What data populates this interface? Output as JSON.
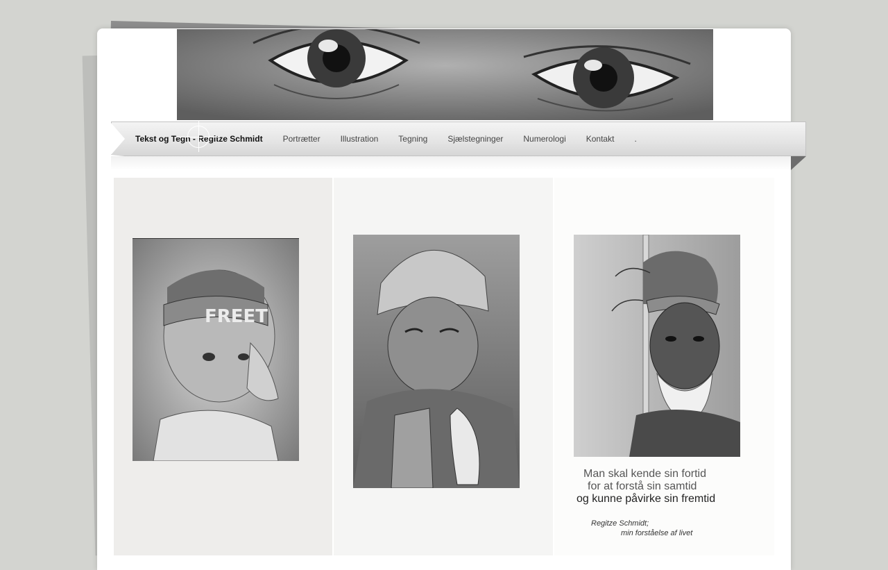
{
  "banner": {
    "image": "eyes-drawing-banner"
  },
  "nav": {
    "items": [
      {
        "label": "Tekst og Tegn - Regitze Schmidt",
        "active": true
      },
      {
        "label": "Portrætter"
      },
      {
        "label": "Illustration"
      },
      {
        "label": "Tegning"
      },
      {
        "label": "Sjælstegninger"
      },
      {
        "label": "Numerologi"
      },
      {
        "label": "Kontakt"
      },
      {
        "label": "."
      }
    ]
  },
  "drawings": {
    "left": {
      "headband_text": "FREET"
    }
  },
  "quote": {
    "line1": "Man skal kende sin fortid",
    "line2": "for at forstå sin samtid",
    "line3": "og kunne påvirke sin fremtid"
  },
  "signature": {
    "line1": "Regitze Schmidt;",
    "line2": "min forståelse af livet"
  },
  "colors": {
    "background": "#d3d4d0",
    "page": "#ffffff"
  }
}
